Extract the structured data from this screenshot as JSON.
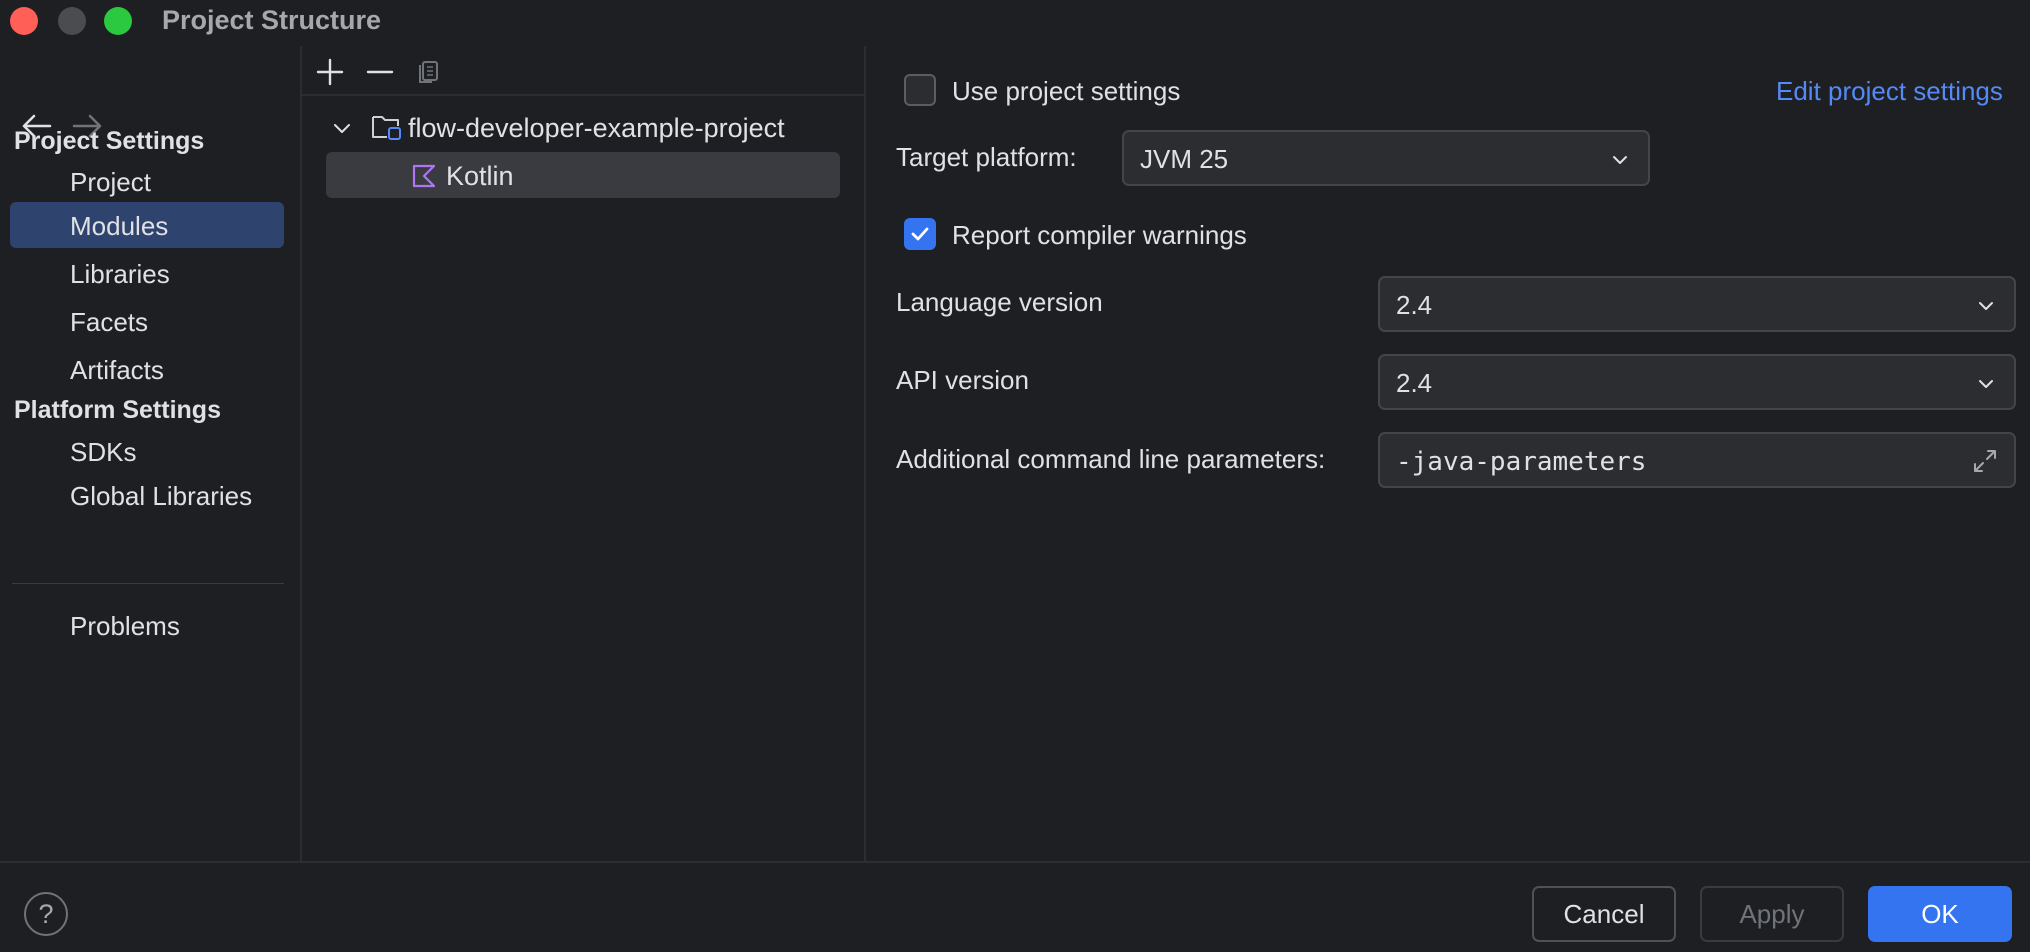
{
  "window": {
    "title": "Project Structure"
  },
  "sidebar": {
    "project_settings_header": "Project Settings",
    "platform_settings_header": "Platform Settings",
    "items": {
      "project": "Project",
      "modules": "Modules",
      "libraries": "Libraries",
      "facets": "Facets",
      "artifacts": "Artifacts",
      "sdks": "SDKs",
      "global_libraries": "Global Libraries",
      "problems": "Problems"
    },
    "selected": "Modules"
  },
  "tree": {
    "toolbar_icons": [
      "add-icon",
      "remove-icon",
      "copy-icon"
    ],
    "root": {
      "label": "flow-developer-example-project",
      "icon": "module-folder-icon",
      "expanded": true
    },
    "children": [
      {
        "label": "Kotlin",
        "icon": "kotlin-icon",
        "selected": true
      }
    ]
  },
  "settings": {
    "use_project_settings": {
      "label": "Use project settings",
      "checked": false
    },
    "edit_project_settings_link": "Edit project settings",
    "target_platform": {
      "label": "Target platform:",
      "value": "JVM 25"
    },
    "report_compiler_warnings": {
      "label": "Report compiler warnings",
      "checked": true
    },
    "language_version": {
      "label": "Language version",
      "value": "2.4"
    },
    "api_version": {
      "label": "API version",
      "value": "2.4"
    },
    "additional_params": {
      "label": "Additional command line parameters:",
      "value": "-java-parameters"
    }
  },
  "footer": {
    "help": "?",
    "cancel": "Cancel",
    "apply": "Apply",
    "ok": "OK"
  },
  "colors": {
    "background": "#1e1f22",
    "selection": "#2e436e",
    "accent": "#3574f0",
    "link": "#548af7"
  }
}
